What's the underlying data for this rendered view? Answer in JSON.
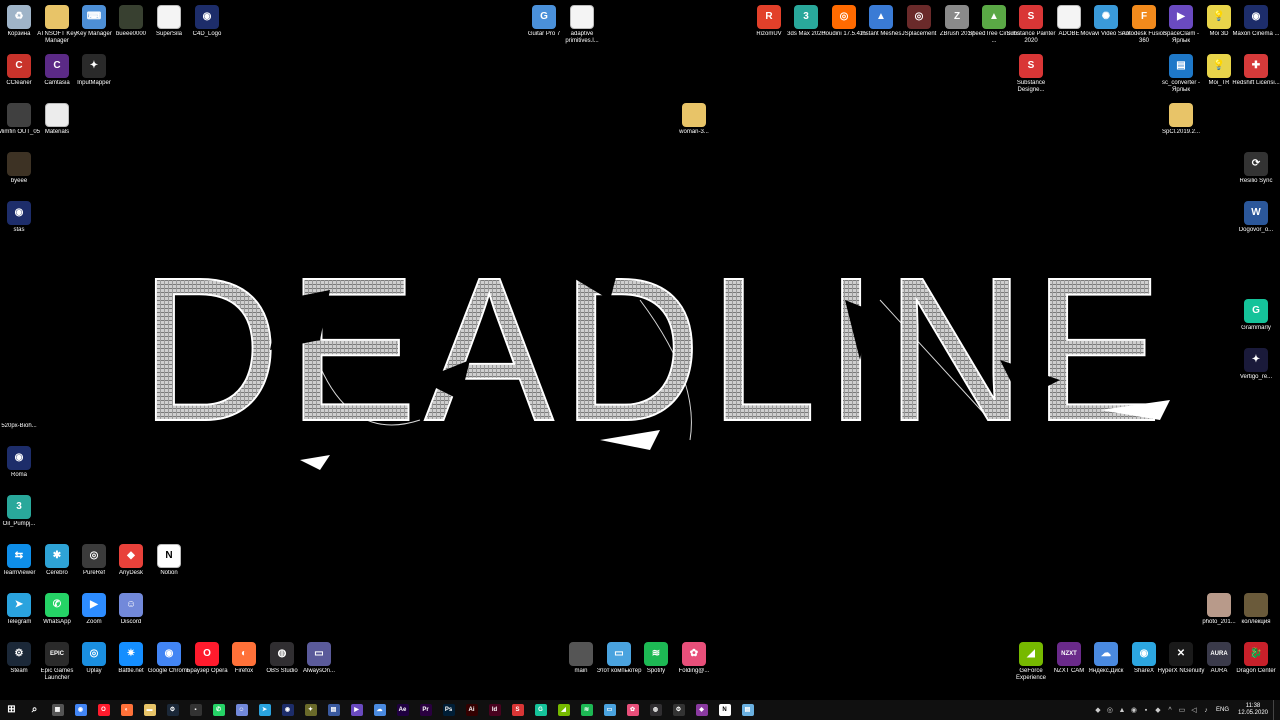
{
  "wallpaper": {
    "text": "DEADLINE",
    "color": "#d8d8d8"
  },
  "desktop_icons": [
    {
      "label": "Корзина",
      "icon": "recycle-bin-icon",
      "color": "#9fb4c8",
      "glyph": "♻"
    },
    {
      "label": "ATNSOFT Key Manager",
      "icon": "folder-icon",
      "color": "#e8c468",
      "glyph": ""
    },
    {
      "label": "Key Manager",
      "icon": "key-manager-icon",
      "color": "#4d8fd6",
      "glyph": "⌨"
    },
    {
      "label": "bueee0000",
      "icon": "image-file-icon",
      "color": "#384030",
      "glyph": ""
    },
    {
      "label": "SuperSila",
      "icon": "document-icon",
      "color": "#f4f4f4",
      "glyph": ""
    },
    {
      "label": "C4D_Logo",
      "icon": "cinema4d-icon",
      "color": "#1d2d6a",
      "glyph": "◉"
    },
    {
      "label": "CCleaner",
      "icon": "ccleaner-icon",
      "color": "#c8332b",
      "glyph": "C"
    },
    {
      "label": "Camtasia",
      "icon": "camtasia-icon",
      "color": "#5b2a86",
      "glyph": "C"
    },
    {
      "label": "InputMapper",
      "icon": "inputmapper-icon",
      "color": "#2a2a2a",
      "glyph": "✦"
    },
    {
      "label": "Mimfin OUT_05",
      "icon": "video-file-icon",
      "color": "#404040",
      "glyph": ""
    },
    {
      "label": "Materials",
      "icon": "text-file-icon",
      "color": "#ececec",
      "glyph": ""
    },
    {
      "label": "byeee",
      "icon": "image-file-icon",
      "color": "#3d3224",
      "glyph": ""
    },
    {
      "label": "stas",
      "icon": "cinema4d-icon",
      "color": "#1d2d6a",
      "glyph": "◉"
    },
    {
      "label": "520px-Bioh...",
      "icon": "image-file-icon",
      "color": "#000000",
      "glyph": ""
    },
    {
      "label": "Roma",
      "icon": "cinema4d-icon",
      "color": "#1d2d6a",
      "glyph": "◉"
    },
    {
      "label": "Oil_Pumpj...",
      "icon": "3dsmax-file-icon",
      "color": "#29a89b",
      "glyph": "3"
    },
    {
      "label": "TeamViewer",
      "icon": "teamviewer-icon",
      "color": "#0e8ee9",
      "glyph": "⇆"
    },
    {
      "label": "Cerebro",
      "icon": "cerebro-icon",
      "color": "#2ea3d6",
      "glyph": "✱"
    },
    {
      "label": "PureRef",
      "icon": "pureref-icon",
      "color": "#3b3b3b",
      "glyph": "◎"
    },
    {
      "label": "AnyDesk",
      "icon": "anydesk-icon",
      "color": "#e8413a",
      "glyph": "◆"
    },
    {
      "label": "Notion",
      "icon": "notion-icon",
      "color": "#ffffff",
      "glyph": "N"
    },
    {
      "label": "Telegram",
      "icon": "telegram-icon",
      "color": "#2aa3de",
      "glyph": "➤"
    },
    {
      "label": "WhatsApp",
      "icon": "whatsapp-icon",
      "color": "#25d366",
      "glyph": "✆"
    },
    {
      "label": "Zoom",
      "icon": "zoom-icon",
      "color": "#2d8cff",
      "glyph": "▶"
    },
    {
      "label": "Discord",
      "icon": "discord-icon",
      "color": "#7289da",
      "glyph": "☺"
    },
    {
      "label": "Steam",
      "icon": "steam-icon",
      "color": "#1b2838",
      "glyph": "⚙"
    },
    {
      "label": "Epic Games Launcher",
      "icon": "epic-games-icon",
      "color": "#2a2a2a",
      "glyph": "EPIC"
    },
    {
      "label": "Uplay",
      "icon": "uplay-icon",
      "color": "#1a8fe0",
      "glyph": "◎"
    },
    {
      "label": "Battle.net",
      "icon": "battlenet-icon",
      "color": "#148eff",
      "glyph": "✷"
    },
    {
      "label": "Google Chrome",
      "icon": "chrome-icon",
      "color": "#4285f4",
      "glyph": "◉"
    },
    {
      "label": "Браузер Opera",
      "icon": "opera-icon",
      "color": "#ff1b2d",
      "glyph": "O"
    },
    {
      "label": "Firefox",
      "icon": "firefox-icon",
      "color": "#ff7139",
      "glyph": "◐"
    },
    {
      "label": "OBS Studio",
      "icon": "obs-icon",
      "color": "#302e31",
      "glyph": "◍"
    },
    {
      "label": "AlwaysOn...",
      "icon": "alwayson-icon",
      "color": "#5a5a9a",
      "glyph": "▭"
    },
    {
      "label": "Guitar Pro 7",
      "icon": "guitar-pro-icon",
      "color": "#4a90d9",
      "glyph": "G"
    },
    {
      "label": "adaptive primitives.l...",
      "icon": "document-icon",
      "color": "#f4f4f4",
      "glyph": ""
    },
    {
      "label": "woman-3...",
      "icon": "zip-folder-icon",
      "color": "#e8c468",
      "glyph": ""
    },
    {
      "label": "main",
      "icon": "image-file-icon",
      "color": "#555555",
      "glyph": ""
    },
    {
      "label": "Этот компьютер",
      "icon": "this-pc-icon",
      "color": "#4aa3df",
      "glyph": "▭"
    },
    {
      "label": "Spotify",
      "icon": "spotify-icon",
      "color": "#1db954",
      "glyph": "≋"
    },
    {
      "label": "Folding@...",
      "icon": "folding-icon",
      "color": "#e84f7a",
      "glyph": "✿"
    },
    {
      "label": "RizomUV",
      "icon": "rizomuv-icon",
      "color": "#e2402a",
      "glyph": "R"
    },
    {
      "label": "3ds Max 2020",
      "icon": "3dsmax-icon",
      "color": "#29a89b",
      "glyph": "3"
    },
    {
      "label": "Houdini 17.5.425",
      "icon": "houdini-icon",
      "color": "#ff6a00",
      "glyph": "◎"
    },
    {
      "label": "Instant Meshes",
      "icon": "instant-meshes-icon",
      "color": "#3a7bd5",
      "glyph": "▲"
    },
    {
      "label": "JSplacement",
      "icon": "jsplacement-icon",
      "color": "#6a2a2a",
      "glyph": "◎"
    },
    {
      "label": "ZBrush 2019",
      "icon": "zbrush-icon",
      "color": "#8a8a8a",
      "glyph": "Z"
    },
    {
      "label": "SpeedTree Cinema ...",
      "icon": "speedtree-icon",
      "color": "#5aa845",
      "glyph": "▲"
    },
    {
      "label": "Substance Painter 2020",
      "icon": "substance-painter-icon",
      "color": "#d93636",
      "glyph": "S"
    },
    {
      "label": "ADOBE",
      "icon": "document-icon",
      "color": "#f4f4f4",
      "glyph": ""
    },
    {
      "label": "Movavi Video Suite",
      "icon": "movavi-icon",
      "color": "#3a9ad9",
      "glyph": "✺"
    },
    {
      "label": "Autodesk Fusion 360",
      "icon": "fusion360-icon",
      "color": "#f28a1c",
      "glyph": "F"
    },
    {
      "label": "SpaceClaim - Ярлык",
      "icon": "spaceclaim-icon",
      "color": "#6a4ac0",
      "glyph": "▶"
    },
    {
      "label": "Moi 3D",
      "icon": "moi3d-icon",
      "color": "#e8d44a",
      "glyph": "💡"
    },
    {
      "label": "Maxon Cinema ...",
      "icon": "cinema4d-icon",
      "color": "#1d2d6a",
      "glyph": "◉"
    },
    {
      "label": "Substance Designe...",
      "icon": "substance-designer-icon",
      "color": "#d93636",
      "glyph": "S"
    },
    {
      "label": "sc_converter - Ярлык",
      "icon": "sc-converter-icon",
      "color": "#1e78c8",
      "glyph": "▤"
    },
    {
      "label": "Moi_TR",
      "icon": "moi3d-icon",
      "color": "#e8d44a",
      "glyph": "💡"
    },
    {
      "label": "Redshift Licensi...",
      "icon": "redshift-icon",
      "color": "#d63a3a",
      "glyph": "✚"
    },
    {
      "label": "SpCl.2019.2...",
      "icon": "zip-folder-icon",
      "color": "#e8c468",
      "glyph": ""
    },
    {
      "label": "Resilio Sync",
      "icon": "resilio-icon",
      "color": "#333333",
      "glyph": "⟳"
    },
    {
      "label": "Dogovor_o...",
      "icon": "word-doc-icon",
      "color": "#2b579a",
      "glyph": "W"
    },
    {
      "label": "Grammarly",
      "icon": "grammarly-icon",
      "color": "#15c39a",
      "glyph": "G"
    },
    {
      "label": "Vertigo_re...",
      "icon": "image-file-icon",
      "color": "#1a1a3a",
      "glyph": "✦"
    },
    {
      "label": "photo_201...",
      "icon": "image-file-icon",
      "color": "#b89a8a",
      "glyph": ""
    },
    {
      "label": "коллекция",
      "icon": "image-file-icon",
      "color": "#6a5a3a",
      "glyph": ""
    },
    {
      "label": "GeForce Experience",
      "icon": "geforce-icon",
      "color": "#76b900",
      "glyph": "◢"
    },
    {
      "label": "NZXT CAM",
      "icon": "nzxt-icon",
      "color": "#6a2a8a",
      "glyph": "NZXT"
    },
    {
      "label": "Яндекс.Диск",
      "icon": "yandex-disk-icon",
      "color": "#4a8ae0",
      "glyph": "☁"
    },
    {
      "label": "ShareX",
      "icon": "sharex-icon",
      "color": "#2ca6e0",
      "glyph": "◉"
    },
    {
      "label": "HyperX NGenuity",
      "icon": "hyperx-icon",
      "color": "#1a1a1a",
      "glyph": "✕"
    },
    {
      "label": "AURA",
      "icon": "aura-icon",
      "color": "#3a3a4a",
      "glyph": "AURA"
    },
    {
      "label": "Dragon Center",
      "icon": "dragon-center-icon",
      "color": "#c8202a",
      "glyph": "🐉"
    }
  ],
  "taskbar": {
    "items": [
      {
        "icon": "start-icon",
        "color": "#ffffff",
        "glyph": "⊞"
      },
      {
        "icon": "search-icon",
        "color": "#ffffff",
        "glyph": "⌕"
      },
      {
        "icon": "calculator-icon",
        "color": "#555555",
        "glyph": "▦"
      },
      {
        "icon": "chrome-icon",
        "color": "#4285f4",
        "glyph": "◉"
      },
      {
        "icon": "opera-icon",
        "color": "#ff1b2d",
        "glyph": "O"
      },
      {
        "icon": "firefox-icon",
        "color": "#ff7139",
        "glyph": "◐"
      },
      {
        "icon": "file-explorer-icon",
        "color": "#e8c468",
        "glyph": "▬"
      },
      {
        "icon": "steam-icon",
        "color": "#1b2838",
        "glyph": "⚙"
      },
      {
        "icon": "discord-taskbar-icon",
        "color": "#333333",
        "glyph": "▪"
      },
      {
        "icon": "whatsapp-icon",
        "color": "#25d366",
        "glyph": "✆"
      },
      {
        "icon": "discord-icon",
        "color": "#7289da",
        "glyph": "☺"
      },
      {
        "icon": "telegram-icon",
        "color": "#2aa3de",
        "glyph": "➤"
      },
      {
        "icon": "cinema4d-icon",
        "color": "#1d2d6a",
        "glyph": "◉"
      },
      {
        "icon": "inputmapper-icon",
        "color": "#6a6a2a",
        "glyph": "✦"
      },
      {
        "icon": "app-icon",
        "color": "#3a5aa0",
        "glyph": "▤"
      },
      {
        "icon": "spaceclaim-icon",
        "color": "#6a4ac0",
        "glyph": "▶"
      },
      {
        "icon": "yandex-disk-icon",
        "color": "#4a8ae0",
        "glyph": "☁"
      },
      {
        "icon": "after-effects-icon",
        "color": "#1f0040",
        "glyph": "Ae"
      },
      {
        "icon": "premiere-icon",
        "color": "#2a0040",
        "glyph": "Pr"
      },
      {
        "icon": "photoshop-icon",
        "color": "#001e36",
        "glyph": "Ps"
      },
      {
        "icon": "illustrator-icon",
        "color": "#330000",
        "glyph": "Ai"
      },
      {
        "icon": "indesign-icon",
        "color": "#49021f",
        "glyph": "Id"
      },
      {
        "icon": "substance-painter-icon",
        "color": "#d93636",
        "glyph": "S"
      },
      {
        "icon": "grammarly-icon",
        "color": "#15c39a",
        "glyph": "G"
      },
      {
        "icon": "nvidia-icon",
        "color": "#76b900",
        "glyph": "◢"
      },
      {
        "icon": "spotify-icon",
        "color": "#1db954",
        "glyph": "≋"
      },
      {
        "icon": "this-pc-icon",
        "color": "#4aa3df",
        "glyph": "▭"
      },
      {
        "icon": "folding-icon",
        "color": "#e84f7a",
        "glyph": "✿"
      },
      {
        "icon": "obs-icon",
        "color": "#302e31",
        "glyph": "◍"
      },
      {
        "icon": "settings-icon",
        "color": "#333333",
        "glyph": "⚙"
      },
      {
        "icon": "app2-icon",
        "color": "#8a3aa0",
        "glyph": "◆"
      },
      {
        "icon": "notion-icon",
        "color": "#ffffff",
        "glyph": "N"
      },
      {
        "icon": "notepad-icon",
        "color": "#6ab0e0",
        "glyph": "▤"
      }
    ],
    "tray": {
      "icons": [
        {
          "icon": "tray-icon-1",
          "glyph": "◆"
        },
        {
          "icon": "tray-icon-2",
          "glyph": "◎"
        },
        {
          "icon": "tray-icon-3",
          "glyph": "▲"
        },
        {
          "icon": "tray-icon-4",
          "glyph": "◉"
        },
        {
          "icon": "tray-icon-5",
          "glyph": "▪"
        },
        {
          "icon": "tray-icon-6",
          "glyph": "◆"
        },
        {
          "icon": "chevron-up-icon",
          "glyph": "^"
        },
        {
          "icon": "network-icon",
          "glyph": "▭"
        },
        {
          "icon": "volume-icon",
          "glyph": "◁"
        },
        {
          "icon": "speaker-icon",
          "glyph": "♪"
        }
      ],
      "language": "ENG",
      "time": "11:38",
      "date": "12.05.2020"
    }
  }
}
